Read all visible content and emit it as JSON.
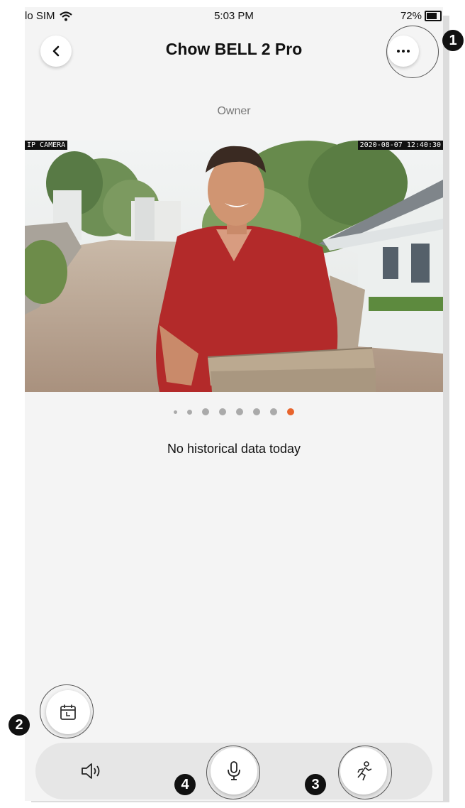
{
  "status_bar": {
    "carrier": "lo SIM",
    "time": "5:03 PM",
    "battery": "72%"
  },
  "header": {
    "title": "Chow BELL 2 Pro"
  },
  "role_label": "Owner",
  "camera": {
    "left_tag": "IP CAMERA",
    "timestamp": "2020-08-07  12:40:30"
  },
  "pager": {
    "count": 8,
    "active_index": 7,
    "active_color": "#e8642c"
  },
  "empty_message": "No historical data today",
  "callouts": {
    "more": "1",
    "calendar": "2",
    "motion": "3",
    "mic": "4"
  },
  "colors": {
    "accent": "#e8642c",
    "background": "#f4f4f4",
    "toolbar": "#e6e6e6"
  },
  "icons": [
    "back-chevron-icon",
    "more-dots-icon",
    "calendar-icon",
    "speaker-icon",
    "microphone-icon",
    "motion-person-icon"
  ]
}
